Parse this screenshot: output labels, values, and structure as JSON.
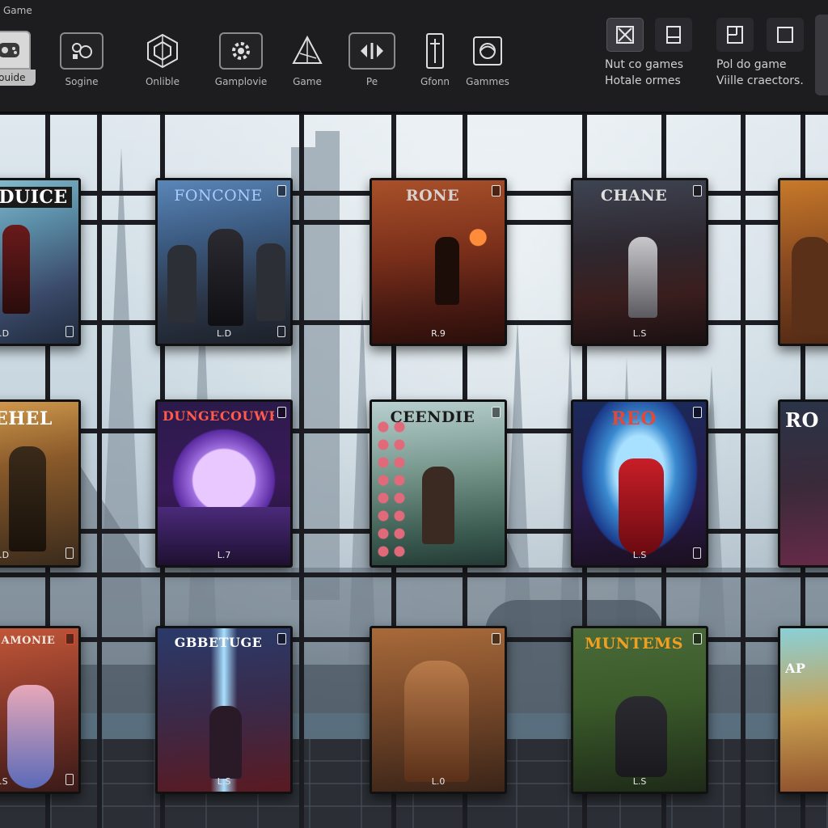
{
  "app": {
    "title": "Game"
  },
  "toolbar": {
    "tools": [
      {
        "label": "Souide",
        "icon": "controller-icon"
      },
      {
        "label": "Sogine",
        "icon": "palette-icon"
      },
      {
        "label": "Onlible",
        "icon": "hexagon-rune-icon"
      },
      {
        "label": "Gamplovie",
        "icon": "gear-icon"
      },
      {
        "label": "Game",
        "icon": "triangle-compass-icon"
      },
      {
        "label": "Pe",
        "icon": "split-arrows-icon"
      },
      {
        "label": "Gfonn",
        "icon": "sword-pillar-icon"
      },
      {
        "label": "Gammes",
        "icon": "ornate-emblem-icon"
      }
    ],
    "options": {
      "left_note": [
        "Nut co games",
        "Hotale ormes"
      ],
      "right_note": [
        "Pol do game",
        "Viille craectors."
      ]
    }
  },
  "cards": [
    {
      "title": "DUICE",
      "rating": "L.D",
      "title_color": "#ffffff"
    },
    {
      "title": "FONCONE",
      "rating": "L.D",
      "title_color": "#a9c9ff"
    },
    {
      "title": "RONE",
      "rating": "R.9",
      "title_color": "#d9d0d0"
    },
    {
      "title": "CHANE",
      "rating": "L.S",
      "title_color": "#e0e0e0"
    },
    {
      "title": "",
      "rating": "",
      "title_color": "#ffffff"
    },
    {
      "title": "EHEL",
      "rating": "L.D",
      "title_color": "#ffffff"
    },
    {
      "title": "DUNGECOUWER",
      "rating": "L.7",
      "title_color": "#ff5a4a"
    },
    {
      "title": "CEENDIE",
      "rating": "",
      "title_color": "#1a1a1a"
    },
    {
      "title": "REO",
      "rating": "L.S",
      "title_color": "#e04a3a"
    },
    {
      "title": "RO",
      "rating": "",
      "title_color": "#ffffff"
    },
    {
      "title": "AMONIE",
      "rating": "L.S",
      "title_color": "#f0e8e0"
    },
    {
      "title": "GBBETUGE",
      "rating": "L.S",
      "title_color": "#ffffff"
    },
    {
      "title": "",
      "rating": "L.0",
      "title_color": "#ffffff"
    },
    {
      "title": "MUNTEMS",
      "rating": "L.S",
      "title_color": "#f0a020"
    },
    {
      "title": "AP",
      "rating": "",
      "title_color": "#ffffff"
    }
  ]
}
